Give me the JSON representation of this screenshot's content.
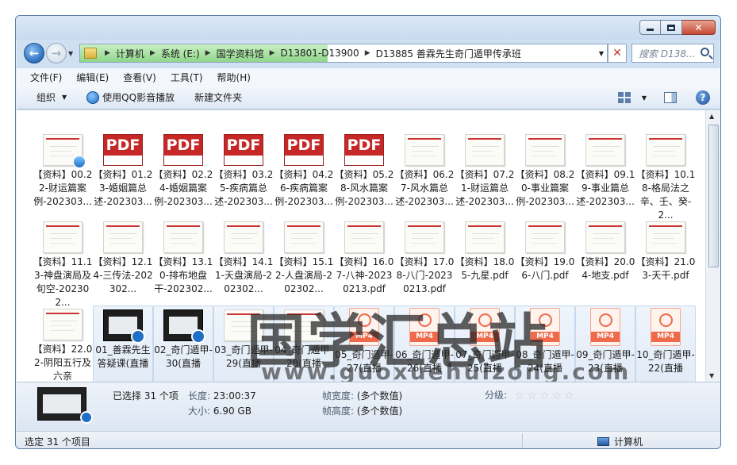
{
  "window": {
    "controls": {
      "minimize": "minimize",
      "maximize": "maximize",
      "close": "✕"
    }
  },
  "address": {
    "breadcrumbs": [
      "计算机",
      "系统 (E:)",
      "国学资料馆",
      "D13801-D13900",
      "D13885 善霖先生奇门遁甲传承班"
    ],
    "search_placeholder": "搜索 D138...",
    "progress": 0.47
  },
  "menu": [
    "文件(F)",
    "编辑(E)",
    "查看(V)",
    "工具(T)",
    "帮助(H)"
  ],
  "toolbar": {
    "organize": "组织",
    "qq_play": "使用QQ影音播放",
    "new_folder": "新建文件夹"
  },
  "files": [
    {
      "type": "doc-badge",
      "label": "【资料】00.22-财运篇案例-202303..."
    },
    {
      "type": "pdf",
      "thumb": "PDF",
      "label": "【资料】01.23-婚姻篇总述-202303..."
    },
    {
      "type": "pdf",
      "thumb": "PDF",
      "label": "【资料】02.24-婚姻篇案例-202303..."
    },
    {
      "type": "pdf",
      "thumb": "PDF",
      "label": "【资料】03.25-疾病篇总述-202303..."
    },
    {
      "type": "pdf",
      "thumb": "PDF",
      "label": "【资料】04.26-疾病篇案例-202303..."
    },
    {
      "type": "pdf",
      "thumb": "PDF",
      "label": "【资料】05.28-风水篇案例-202303..."
    },
    {
      "type": "doc",
      "label": "【资料】06.27-风水篇总述-202303..."
    },
    {
      "type": "doc",
      "label": "【资料】07.21-财运篇总述-202303..."
    },
    {
      "type": "doc",
      "label": "【资料】08.20-事业篇案例-202303..."
    },
    {
      "type": "doc",
      "label": "【资料】09.19-事业篇总述-202303..."
    },
    {
      "type": "doc",
      "label": "【资料】10.18-格局法之辛、壬、癸-2..."
    },
    {
      "type": "doc",
      "label": "【资料】11.13-神盘演局及旬空-202302..."
    },
    {
      "type": "doc",
      "label": "【资料】12.14-三传法-202302..."
    },
    {
      "type": "doc",
      "label": "【资料】13.10-排布地盘干-202302..."
    },
    {
      "type": "doc",
      "label": "【资料】14.11-天盘演局-202302..."
    },
    {
      "type": "doc",
      "label": "【资料】15.12-人盘演局-202302..."
    },
    {
      "type": "doc",
      "label": "【资料】16.07-八神-20230213.pdf"
    },
    {
      "type": "doc",
      "label": "【资料】17.08-八门-20230213.pdf"
    },
    {
      "type": "doc",
      "label": "【资料】18.05-九星.pdf"
    },
    {
      "type": "doc",
      "label": "【资料】19.06-八门.pdf"
    },
    {
      "type": "doc",
      "label": "【资料】20.04-地支.pdf"
    },
    {
      "type": "doc",
      "label": "【资料】21.03-天干.pdf"
    },
    {
      "type": "doc",
      "label": "【资料】22.02-阴阳五行及六亲"
    },
    {
      "type": "video",
      "label": "01_善霖先生答疑课(直播"
    },
    {
      "type": "video",
      "label": "02_奇门遁甲-30(直播"
    },
    {
      "type": "doc",
      "label": "03_奇门遁甲-29(直播"
    },
    {
      "type": "doc",
      "label": "04_奇门遁甲-28(直播"
    },
    {
      "type": "mp4",
      "thumb": "MP4",
      "label": "05_奇门遁甲-27(直播"
    },
    {
      "type": "mp4",
      "thumb": "MP4",
      "label": "06_奇门遁甲-26(直播"
    },
    {
      "type": "mp4",
      "thumb": "MP4",
      "label": "07_奇门遁甲-25(直播"
    },
    {
      "type": "mp4",
      "thumb": "MP4",
      "label": "08_奇门遁甲-24(直播"
    },
    {
      "type": "mp4",
      "thumb": "MP4",
      "label": "09_奇门遁甲-23(直播"
    },
    {
      "type": "mp4",
      "thumb": "MP4",
      "label": "10_奇门遁甲-22(直播"
    }
  ],
  "watermark": {
    "line1": "国学汇总站",
    "line2": "www.guoxuehuizong.com"
  },
  "details": {
    "selected": "已选择 31 个项",
    "duration_key": "长度:",
    "duration_val": "23:00:37",
    "size_key": "大小:",
    "size_val": "6.90 GB",
    "framewidth_key": "帧宽度:",
    "framewidth_val": "(多个数值)",
    "frameheight_key": "帧高度:",
    "frameheight_val": "(多个数值)",
    "rating_key": "分级:",
    "rating_stars": 0
  },
  "status": {
    "left": "选定 31 个项目",
    "right": "计算机"
  }
}
